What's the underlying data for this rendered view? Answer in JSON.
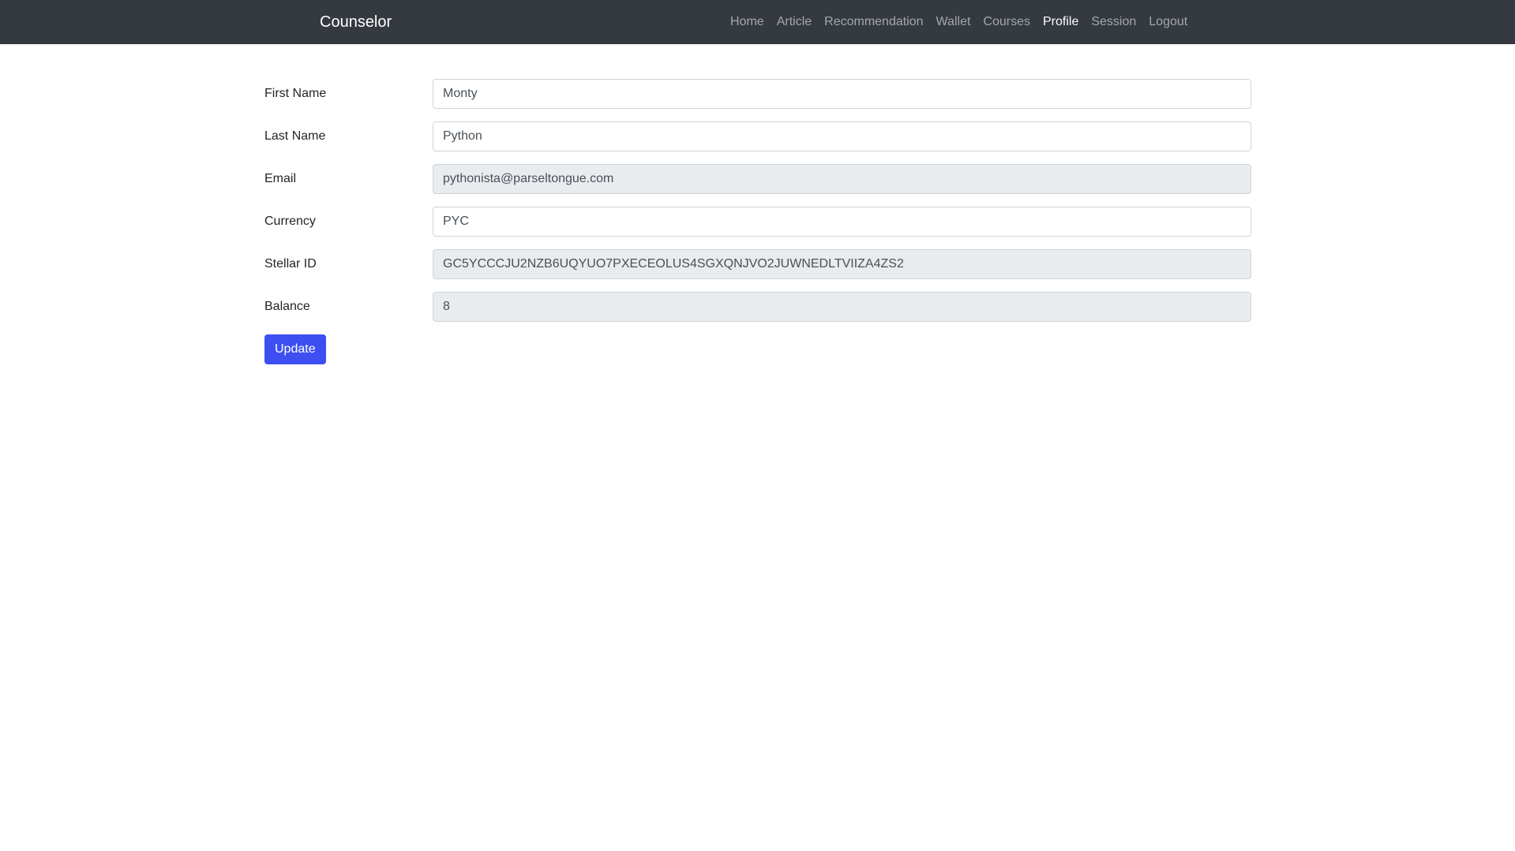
{
  "navbar": {
    "brand": "Counselor",
    "items": [
      {
        "label": "Home",
        "active": false
      },
      {
        "label": "Article",
        "active": false
      },
      {
        "label": "Recommendation",
        "active": false
      },
      {
        "label": "Wallet",
        "active": false
      },
      {
        "label": "Courses",
        "active": false
      },
      {
        "label": "Profile",
        "active": true
      },
      {
        "label": "Session",
        "active": false
      },
      {
        "label": "Logout",
        "active": false
      }
    ]
  },
  "form": {
    "fields": [
      {
        "label": "First Name",
        "value": "Monty",
        "readonly": false
      },
      {
        "label": "Last Name",
        "value": "Python",
        "readonly": false
      },
      {
        "label": "Email",
        "value": "pythonista@parseltongue.com",
        "readonly": true
      },
      {
        "label": "Currency",
        "value": "PYC",
        "readonly": false
      },
      {
        "label": "Stellar ID",
        "value": "GC5YCCCJU2NZB6UQYUO7PXECEOLUS4SGXQNJVO2JUWNEDLTVIIZA4ZS2",
        "readonly": true
      },
      {
        "label": "Balance",
        "value": "8",
        "readonly": true
      }
    ],
    "submit_label": "Update"
  },
  "colors": {
    "navbar_bg": "#343a40",
    "primary": "#3d4ff0",
    "readonly_bg": "#e9ecef"
  }
}
